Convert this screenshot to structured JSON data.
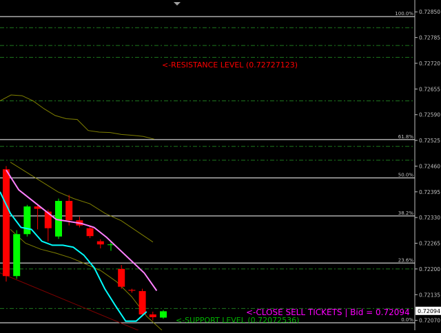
{
  "colors": {
    "background": "#000000",
    "bull": "#00ff00",
    "bear": "#ff0000",
    "axis_text": "#c0c0c0",
    "fib_line": "#ffffff",
    "dashdot": "#1e7a1e",
    "resistance_text": "#ff0000",
    "support_text": "#00b400",
    "close_text": "#ff00ff",
    "price_box_bg": "#ffffff",
    "price_box_text": "#000000",
    "ma_fast": "#00ffff",
    "ma_slow": "#ff80ff",
    "envelope": "#808000",
    "trend_line": "#800000"
  },
  "chart_data": {
    "type": "candlestick",
    "ylim": [
      0.72045,
      0.7288
    ],
    "y_ticks": [
      "0.72850",
      "0.72785",
      "0.72720",
      "0.72655",
      "0.72590",
      "0.72525",
      "0.72460",
      "0.72395",
      "0.72330",
      "0.72265",
      "0.72200",
      "0.72135",
      "0.72070"
    ],
    "current_price": "0.72094",
    "fibonacci_levels": [
      {
        "label": "100.0%",
        "price": 0.72838
      },
      {
        "label": "61.8%",
        "price": 0.72527
      },
      {
        "label": "50.0%",
        "price": 0.7243
      },
      {
        "label": "38.2%",
        "price": 0.72334
      },
      {
        "label": "23.6%",
        "price": 0.72215
      },
      {
        "label": "0.0%",
        "price": 0.72064
      }
    ],
    "dashed_levels": [
      0.7281,
      0.72765,
      0.72735,
      0.72625,
      0.7251,
      0.72475,
      0.722,
      0.721
    ],
    "annotations": {
      "resistance": "<-RESISTANCE LEVEL (0.72727123)",
      "support": "<-SUPPORT LEVEL (0.72072536)",
      "close_sell": "<-CLOSE SELL TICKETS | Bid = 0.72094"
    },
    "candles": [
      {
        "o": 0.72452,
        "h": 0.7246,
        "l": 0.72168,
        "c": 0.72182
      },
      {
        "o": 0.72182,
        "h": 0.72298,
        "l": 0.72175,
        "c": 0.72288
      },
      {
        "o": 0.72288,
        "h": 0.72362,
        "l": 0.72282,
        "c": 0.72358
      },
      {
        "o": 0.72358,
        "h": 0.72362,
        "l": 0.723,
        "c": 0.72352
      },
      {
        "o": 0.72345,
        "h": 0.7235,
        "l": 0.7227,
        "c": 0.72303
      },
      {
        "o": 0.72282,
        "h": 0.72378,
        "l": 0.72276,
        "c": 0.72372
      },
      {
        "o": 0.72372,
        "h": 0.72387,
        "l": 0.7231,
        "c": 0.72323
      },
      {
        "o": 0.72323,
        "h": 0.72332,
        "l": 0.72305,
        "c": 0.7231
      },
      {
        "o": 0.72303,
        "h": 0.7231,
        "l": 0.72278,
        "c": 0.72283
      },
      {
        "o": 0.7227,
        "h": 0.72275,
        "l": 0.72252,
        "c": 0.72262
      },
      {
        "o": 0.72262,
        "h": 0.7227,
        "l": 0.72246,
        "c": 0.72262
      },
      {
        "o": 0.722,
        "h": 0.7221,
        "l": 0.7215,
        "c": 0.72155
      },
      {
        "o": 0.72147,
        "h": 0.7215,
        "l": 0.7214,
        "c": 0.72145
      },
      {
        "o": 0.72144,
        "h": 0.7215,
        "l": 0.7208,
        "c": 0.72085
      },
      {
        "o": 0.72085,
        "h": 0.72092,
        "l": 0.7207,
        "c": 0.72078
      },
      {
        "o": 0.72077,
        "h": 0.72096,
        "l": 0.72074,
        "c": 0.72093
      }
    ],
    "ma_fast": [
      0.72395,
      0.7234,
      0.72305,
      0.723,
      0.7227,
      0.7226,
      0.7226,
      0.72255,
      0.72235,
      0.72203,
      0.7215,
      0.72108,
      0.72068,
      0.72068,
      0.72092
    ],
    "ma_slow": [
      0.7245,
      0.724,
      0.72375,
      0.7235,
      0.72325,
      0.7232,
      0.72315,
      0.72305,
      0.7228,
      0.7225,
      0.7222,
      0.7219,
      0.72145
    ],
    "envelope_upper": [
      0.72625,
      0.7264,
      0.72638,
      0.72625,
      0.72605,
      0.72588,
      0.7258,
      0.72578,
      0.7255,
      0.72546,
      0.72545,
      0.7254,
      0.72538,
      0.72535,
      0.72528
    ],
    "envelope_mid": [
      0.7247,
      0.72445,
      0.7242,
      0.72395,
      0.72378,
      0.72365,
      0.7234,
      0.72322,
      0.72295,
      0.72268
    ],
    "envelope_lower": [
      0.723,
      0.72265,
      0.7225,
      0.7224,
      0.72228,
      0.72212,
      0.72195,
      0.72168,
      0.7213,
      0.7208,
      0.72045
    ]
  }
}
